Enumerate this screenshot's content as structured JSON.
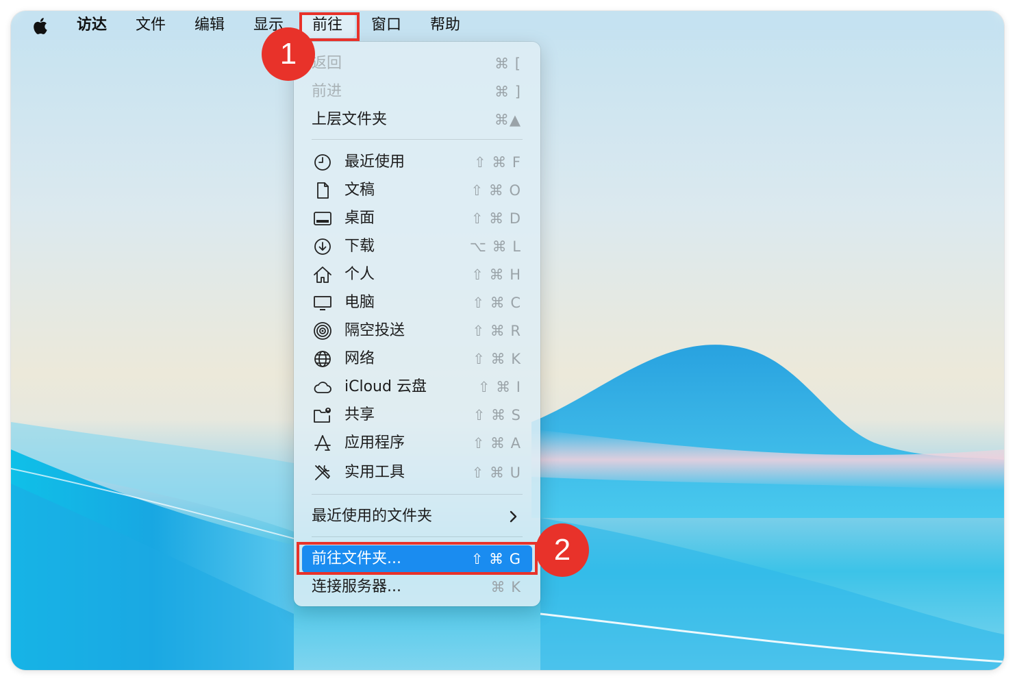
{
  "menubar": {
    "items": [
      {
        "label": "访达",
        "bold": true
      },
      {
        "label": "文件"
      },
      {
        "label": "编辑"
      },
      {
        "label": "显示"
      },
      {
        "label": "前往",
        "active": true
      },
      {
        "label": "窗口"
      },
      {
        "label": "帮助"
      }
    ]
  },
  "badges": {
    "one": "1",
    "two": "2"
  },
  "menu": {
    "back": {
      "label": "返回",
      "shortcut": "⌘ ["
    },
    "forward": {
      "label": "前进",
      "shortcut": "⌘ ]"
    },
    "enclosing": {
      "label": "上层文件夹",
      "shortcut": "⌘▲"
    },
    "places": [
      {
        "label": "最近使用",
        "shortcut": "⇧ ⌘ F",
        "icon": "clock-icon"
      },
      {
        "label": "文稿",
        "shortcut": "⇧ ⌘ O",
        "icon": "document-icon"
      },
      {
        "label": "桌面",
        "shortcut": "⇧ ⌘ D",
        "icon": "desktop-icon"
      },
      {
        "label": "下载",
        "shortcut": "⌥ ⌘ L",
        "icon": "download-icon"
      },
      {
        "label": "个人",
        "shortcut": "⇧ ⌘ H",
        "icon": "home-icon"
      },
      {
        "label": "电脑",
        "shortcut": "⇧ ⌘ C",
        "icon": "computer-icon"
      },
      {
        "label": "隔空投送",
        "shortcut": "⇧ ⌘ R",
        "icon": "airdrop-icon"
      },
      {
        "label": "网络",
        "shortcut": "⇧ ⌘ K",
        "icon": "network-icon"
      },
      {
        "label": "iCloud 云盘",
        "shortcut": "⇧ ⌘ I",
        "icon": "icloud-icon"
      },
      {
        "label": "共享",
        "shortcut": "⇧ ⌘ S",
        "icon": "shared-folder-icon"
      },
      {
        "label": "应用程序",
        "shortcut": "⇧ ⌘ A",
        "icon": "applications-icon"
      },
      {
        "label": "实用工具",
        "shortcut": "⇧ ⌘ U",
        "icon": "utilities-icon"
      }
    ],
    "recent_folders": {
      "label": "最近使用的文件夹"
    },
    "goto_folder": {
      "label": "前往文件夹...",
      "shortcut": "⇧ ⌘ G"
    },
    "connect_server": {
      "label": "连接服务器...",
      "shortcut": "⌘ K"
    }
  }
}
